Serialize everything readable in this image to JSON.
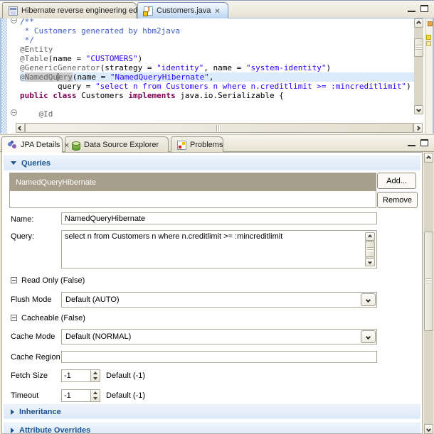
{
  "editor": {
    "tabs": [
      {
        "label": "Hibernate reverse engineering editor",
        "active": false
      },
      {
        "label": "Customers.java",
        "active": true
      }
    ],
    "lines": [
      {
        "fold": true,
        "tokens": [
          {
            "t": "/**",
            "c": "c"
          }
        ]
      },
      {
        "tokens": [
          {
            "t": " * Customers generated by hbm2java",
            "c": "c"
          }
        ]
      },
      {
        "tokens": [
          {
            "t": " */",
            "c": "c"
          }
        ]
      },
      {
        "tokens": [
          {
            "t": "@Entity",
            "c": "a"
          }
        ]
      },
      {
        "tokens": [
          {
            "t": "@Table",
            "c": "a"
          },
          {
            "t": "(name = ",
            "c": "p"
          },
          {
            "t": "\"CUSTOMERS\"",
            "c": "s"
          },
          {
            "t": ")",
            "c": "p"
          }
        ]
      },
      {
        "tokens": [
          {
            "t": "@GenericGenerator",
            "c": "a"
          },
          {
            "t": "(strategy = ",
            "c": "p"
          },
          {
            "t": "\"identity\"",
            "c": "s"
          },
          {
            "t": ", name = ",
            "c": "p"
          },
          {
            "t": "\"system-identity\"",
            "c": "s"
          },
          {
            "t": ")",
            "c": "p"
          }
        ]
      },
      {
        "highlight": true,
        "tokens": [
          {
            "t": "@",
            "c": "a"
          },
          {
            "t": "NamedQu",
            "c": "a",
            "m": true
          },
          {
            "caret": true
          },
          {
            "t": "ery",
            "c": "a",
            "m": true
          },
          {
            "t": "(name = ",
            "c": "p"
          },
          {
            "t": "\"NamedQueryHibernate\"",
            "c": "s"
          },
          {
            "t": ",",
            "c": "p"
          }
        ]
      },
      {
        "tokens": [
          {
            "t": "        query = ",
            "c": "p"
          },
          {
            "t": "\"select n from Customers n where n.creditlimit >= :mincreditlimit\"",
            "c": "s"
          },
          {
            "t": ")",
            "c": "p"
          }
        ]
      },
      {
        "tokens": [
          {
            "t": "public class",
            "c": "k"
          },
          {
            "t": " Customers ",
            "c": "p"
          },
          {
            "t": "implements",
            "c": "k"
          },
          {
            "t": " java.io.Serializable {",
            "c": "p"
          }
        ]
      },
      {
        "tokens": []
      },
      {
        "fold": true,
        "tokens": [
          {
            "t": "    @Id",
            "c": "a"
          }
        ]
      }
    ]
  },
  "details": {
    "tabs": [
      {
        "label": "JPA Details",
        "active": true
      },
      {
        "label": "Data Source Explorer",
        "active": false
      },
      {
        "label": "Problems",
        "active": false
      }
    ],
    "sections": {
      "queries": "Queries",
      "inheritance": "Inheritance",
      "attribute_overrides": "Attribute Overrides"
    },
    "query_list": {
      "items": [
        "NamedQueryHibernate"
      ],
      "selected": 0
    },
    "buttons": {
      "add": "Add...",
      "remove": "Remove"
    },
    "fields": {
      "name": {
        "label": "Name:",
        "value": "NamedQueryHibernate"
      },
      "query": {
        "label": "Query:",
        "value": "select n from Customers n where n.creditlimit >= :mincreditlimit"
      },
      "read_only": {
        "label": "Read Only (False)"
      },
      "flush_mode": {
        "label": "Flush Mode",
        "value": "Default (AUTO)"
      },
      "cacheable": {
        "label": "Cacheable (False)"
      },
      "cache_mode": {
        "label": "Cache Mode",
        "value": "Default (NORMAL)"
      },
      "cache_region": {
        "label": "Cache Region",
        "value": ""
      },
      "fetch_size": {
        "label": "Fetch Size",
        "value": "-1",
        "default_text": "Default (-1)"
      },
      "timeout": {
        "label": "Timeout",
        "value": "-1",
        "default_text": "Default (-1)"
      }
    }
  },
  "colors": {
    "selection_row": "#A79E8C",
    "section_title": "#19518F",
    "active_tab": "#B9D3F1",
    "string": "#2A00FF",
    "keyword": "#7F0055",
    "annotation": "#646464",
    "comment": "#3F5FBF",
    "current_line": "#DCEBFB"
  }
}
